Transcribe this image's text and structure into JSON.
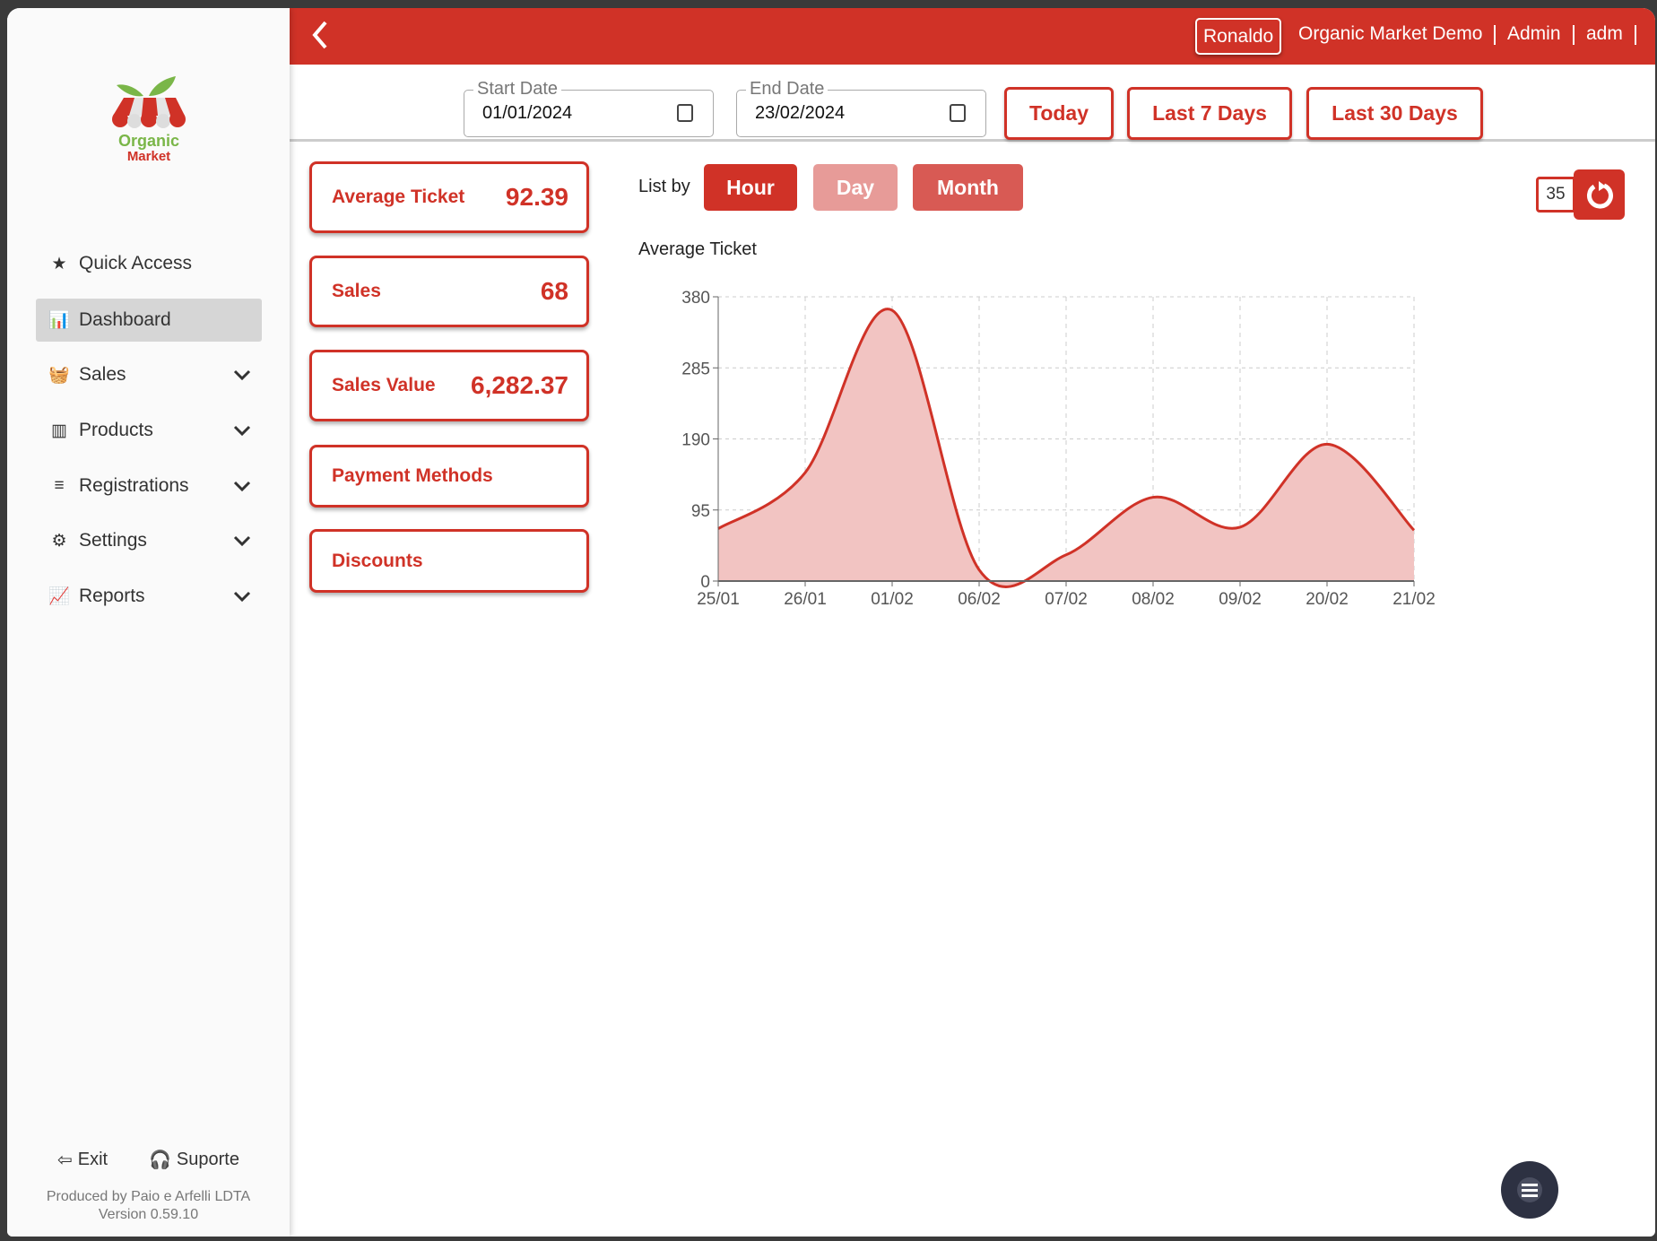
{
  "brand": {
    "line1": "Organic",
    "line2": "Market"
  },
  "sidebar": {
    "items": [
      {
        "label": "Quick Access",
        "icon": "star-icon",
        "glyph": "★",
        "expandable": false,
        "active": false
      },
      {
        "label": "Dashboard",
        "icon": "bar-chart-icon",
        "glyph": "📊",
        "expandable": false,
        "active": true
      },
      {
        "label": "Sales",
        "icon": "basket-icon",
        "glyph": "🧺",
        "expandable": true,
        "active": false
      },
      {
        "label": "Products",
        "icon": "barcode-icon",
        "glyph": "▥",
        "expandable": true,
        "active": false
      },
      {
        "label": "Registrations",
        "icon": "database-icon",
        "glyph": "≡",
        "expandable": true,
        "active": false
      },
      {
        "label": "Settings",
        "icon": "gear-icon",
        "glyph": "⚙",
        "expandable": true,
        "active": false
      },
      {
        "label": "Reports",
        "icon": "line-chart-icon",
        "glyph": "📈",
        "expandable": true,
        "active": false
      }
    ],
    "exit": "Exit",
    "support": "Suporte",
    "produced_by": "Produced by Paio e Arfelli LDTA",
    "version": "Version 0.59.10"
  },
  "header": {
    "user": "Ronaldo",
    "company": "Organic Market Demo",
    "role": "Admin",
    "login": "adm"
  },
  "filters": {
    "start_label": "Start Date",
    "start_value": "01/01/2024",
    "end_label": "End Date",
    "end_value": "23/02/2024",
    "today": "Today",
    "last7": "Last 7 Days",
    "last30": "Last 30 Days"
  },
  "cards": [
    {
      "label": "Average Ticket",
      "value": "92.39"
    },
    {
      "label": "Sales",
      "value": "68"
    },
    {
      "label": "Sales Value",
      "value": "6,282.37"
    },
    {
      "label": "Payment Methods",
      "value": ""
    },
    {
      "label": "Discounts",
      "value": ""
    }
  ],
  "listby": {
    "label": "List by",
    "hour": "Hour",
    "day": "Day",
    "month": "Month"
  },
  "refresh": {
    "count": "35"
  },
  "colors": {
    "primary": "#d03227",
    "fill": "#f2c4c2",
    "day": "#e79b98",
    "month": "#d85a54",
    "fab": "#2d3142"
  },
  "chart_data": {
    "type": "area",
    "title": "Average Ticket",
    "categories": [
      "25/01",
      "26/01",
      "01/02",
      "06/02",
      "07/02",
      "08/02",
      "09/02",
      "20/02",
      "21/02"
    ],
    "values": [
      70,
      145,
      362,
      15,
      35,
      112,
      72,
      183,
      68
    ],
    "yticks": [
      "0",
      "95",
      "190",
      "285",
      "380"
    ],
    "ylim": [
      0,
      380
    ],
    "grid": true,
    "smooth": true
  }
}
